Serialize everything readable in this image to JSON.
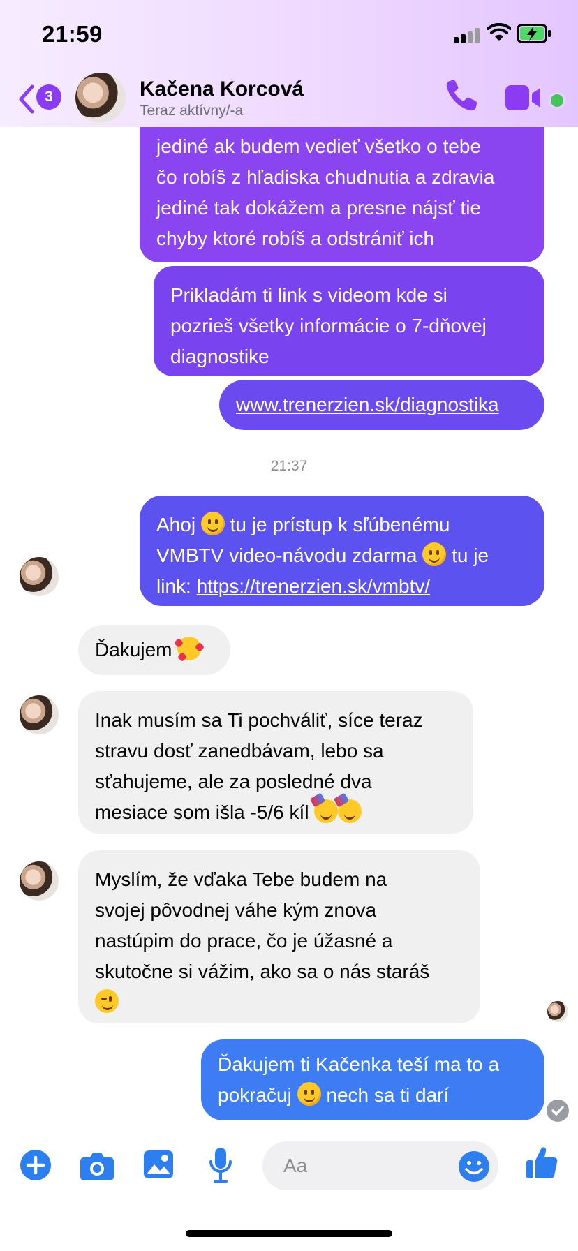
{
  "status_bar": {
    "time": "21:59"
  },
  "header": {
    "unread_count": "3",
    "contact_name": "Kačena Korcová",
    "contact_status": "Teraz aktívny/-a"
  },
  "messages": {
    "out1": {
      "line1": "jediné ak budem vedieť všetko o tebe",
      "line2": "čo robíš z hľadiska chudnutia a zdravia",
      "line3": "jediné tak dokážem a presne nájsť tie",
      "line4": "chyby ktoré robíš a odstrániť ich"
    },
    "out2": {
      "line1": "Prikladám ti link s videom kde si",
      "line2": "pozrieš všetky informácie o 7-dňovej",
      "line3": "diagnostike"
    },
    "out3": {
      "link": "www.trenerzien.sk/diagnostika"
    },
    "timestamp": "21:37",
    "out4": {
      "part1": "Ahoj",
      "part2": "tu je prístup k sľúbenému",
      "part3": "VMBTV video-návodu zdarma",
      "part4": "tu je",
      "part5": "link:",
      "link": "https://trenerzien.sk/vmbtv/"
    },
    "in1": {
      "text": "Ďakujem"
    },
    "in2": {
      "line1": "Inak musím sa Ti pochváliť, síce teraz",
      "line2": "stravu dosť zanedbávam, lebo sa",
      "line3": "sťahujeme, ale za posledné dva",
      "line4": "mesiace som išla -5/6 kíl"
    },
    "in3": {
      "line1": "Myslím, že  vďaka Tebe budem na",
      "line2": "svojej pôvodnej váhe kým znova",
      "line3": "nastúpim do prace, čo je úžasné a",
      "line4": "skutočne si vážim, ako sa o nás staráš"
    },
    "out5": {
      "line1": "Ďakujem ti Kačenka teší ma to a",
      "line2a": "pokračuj",
      "line2b": "nech sa ti darí"
    }
  },
  "composer": {
    "placeholder": "Aa"
  },
  "colors": {
    "accent": "#8b3cf2",
    "outgoing_top": "#8a44f0",
    "outgoing_bottom": "#3d7cf3",
    "incoming": "#f0f0f0",
    "active": "#44c45b"
  }
}
